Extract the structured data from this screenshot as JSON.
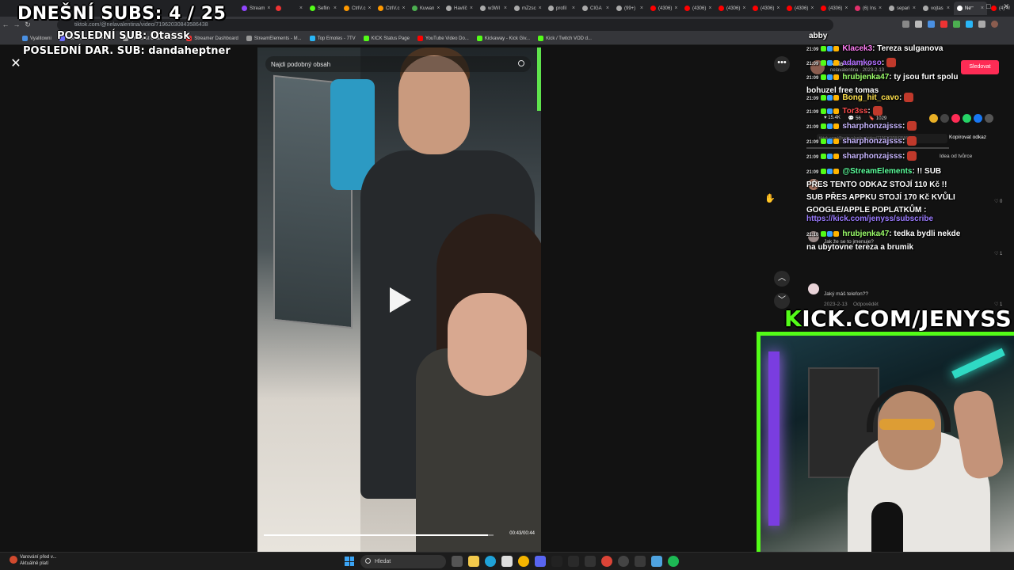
{
  "browser": {
    "tabs": [
      {
        "label": "Stream",
        "color": "#9146ff"
      },
      {
        "label": "",
        "color": "#e33"
      },
      {
        "label": "Seflin",
        "color": "#53fc18"
      },
      {
        "label": "CtrlV.c",
        "color": "#f90"
      },
      {
        "label": "CtrlV.c",
        "color": "#f90"
      },
      {
        "label": "Kuwan",
        "color": "#4caf50"
      },
      {
        "label": "Havlíč",
        "color": "#aaa"
      },
      {
        "label": "w3WI",
        "color": "#aaa"
      },
      {
        "label": "mZzsc",
        "color": "#aaa"
      },
      {
        "label": "profil",
        "color": "#aaa"
      },
      {
        "label": "CIGA",
        "color": "#aaa"
      },
      {
        "label": "(99+)",
        "color": "#aaa"
      },
      {
        "label": "(4306)",
        "color": "#f00"
      },
      {
        "label": "(4306)",
        "color": "#f00"
      },
      {
        "label": "(4306)",
        "color": "#f00"
      },
      {
        "label": "(4306)",
        "color": "#f00"
      },
      {
        "label": "(4306)",
        "color": "#f00"
      },
      {
        "label": "(4306)",
        "color": "#f00"
      },
      {
        "label": "(6) Ins",
        "color": "#e1306c"
      },
      {
        "label": "separi",
        "color": "#aaa"
      },
      {
        "label": "vojtas",
        "color": "#aaa"
      },
      {
        "label": "Ne",
        "color": "#fff",
        "active": true
      },
      {
        "label": "(4) 4!",
        "color": "#f00"
      }
    ],
    "new_tab": "+",
    "url": "tiktok.com/@nelavalentina/video/7196203084358643​8",
    "bookmarks": [
      {
        "label": "Vyalitowni",
        "color": "#4a90e2"
      },
      {
        "label": "File Converter - Free...",
        "color": "#6c6cff"
      },
      {
        "label": "The best ChatBot an...",
        "color": "#999"
      },
      {
        "label": "Streamer Dashboard",
        "color": "#e33"
      },
      {
        "label": "StreamElements - M...",
        "color": "#999"
      },
      {
        "label": "Top Emotes - 7TV",
        "color": "#29b6f6"
      },
      {
        "label": "KICK Status Page",
        "color": "#53fc18"
      },
      {
        "label": "YouTube Video Do...",
        "color": "#f00"
      },
      {
        "label": "Kickaway - Kick Giv...",
        "color": "#53fc18"
      },
      {
        "label": "Kick / Twitch VOD d...",
        "color": "#53fc18"
      }
    ]
  },
  "overlay": {
    "sub_count": "DNEŠNÍ SUBS: 4 / 25",
    "last_sub": "POSLEDNÍ SUB: Otassk",
    "last_donation": "POSLEDNÍ DAR. SUB: dandaheptner",
    "kick_prefix": "K",
    "kick_rest": "ICK.COM/JENYSS"
  },
  "video": {
    "search_placeholder": "Najdi podobný obsah",
    "time": "00:43/00:44",
    "progress": 0.977
  },
  "tiktok": {
    "creator_name": "Nela Valentina",
    "creator_sub": "nelavalentina · 2023-2-13",
    "follow": "Sledovat",
    "likes": "15.4K",
    "comments": "56",
    "saves": "1029",
    "copy_link": "Kopírovat odkaz",
    "comment_1": "Jak že se to jmenuje?",
    "comment_2": "Jaký máš telefon??",
    "comment_2_date": "2023-2-13",
    "reply": "Odpovědět",
    "heart_1": "0",
    "heart_2": "1",
    "heart_3": "1",
    "idea_text": "Idea od tvůrce"
  },
  "chat": [
    {
      "time": "",
      "user": "abby",
      "user_color": "#ffffff",
      "text": ""
    },
    {
      "time": "21:09",
      "user": "Klacek3",
      "user_color": "#ff7ef5",
      "text": ": Tereza sulganova"
    },
    {
      "time": "21:09",
      "user": "adamkoso",
      "user_color": "#b06bff",
      "text": ":"
    },
    {
      "time": "21:09",
      "user": "hrubjenka47",
      "user_color": "#9cff6b",
      "text": ": ty jsou furt spolu bohuzel free tomas"
    },
    {
      "time": "21:09",
      "user": "Bong_hit_cavo",
      "user_color": "#ffe14d",
      "text": ":"
    },
    {
      "time": "21:09",
      "user": "Tor3ss",
      "user_color": "#ff4d4d",
      "text": ":"
    },
    {
      "time": "21:09",
      "user": "sharphonzajsss",
      "user_color": "#c8b6ff",
      "text": ":"
    },
    {
      "time": "21:09",
      "user": "sharphonzajsss",
      "user_color": "#c8b6ff",
      "text": ":"
    },
    {
      "time": "21:09",
      "user": "sharphonzajsss",
      "user_color": "#c8b6ff",
      "text": ":"
    },
    {
      "time": "21:09",
      "user": "@StreamElements",
      "user_color": "#5cff9c",
      "text": ": !! SUB PŘES TENTO ODKAZ STOJÍ 110 Kč !! SUB PŘES APPKU STOJÍ 170 Kč KVŮLI GOOGLE/APPLE POPLATKŮM :"
    },
    {
      "time": "",
      "user": "",
      "user_color": "#9b7bff",
      "text": "https://kick.com/jenyss/subscribe"
    },
    {
      "time": "21:10",
      "user": "hrubjenka47",
      "user_color": "#9cff6b",
      "text": ": tedka bydli nekde na ubytovne tereza a brumik"
    }
  ],
  "taskbar": {
    "weather_line1": "Varování před v...",
    "weather_line2": "Aktuálně platí",
    "search": "Hledat"
  }
}
